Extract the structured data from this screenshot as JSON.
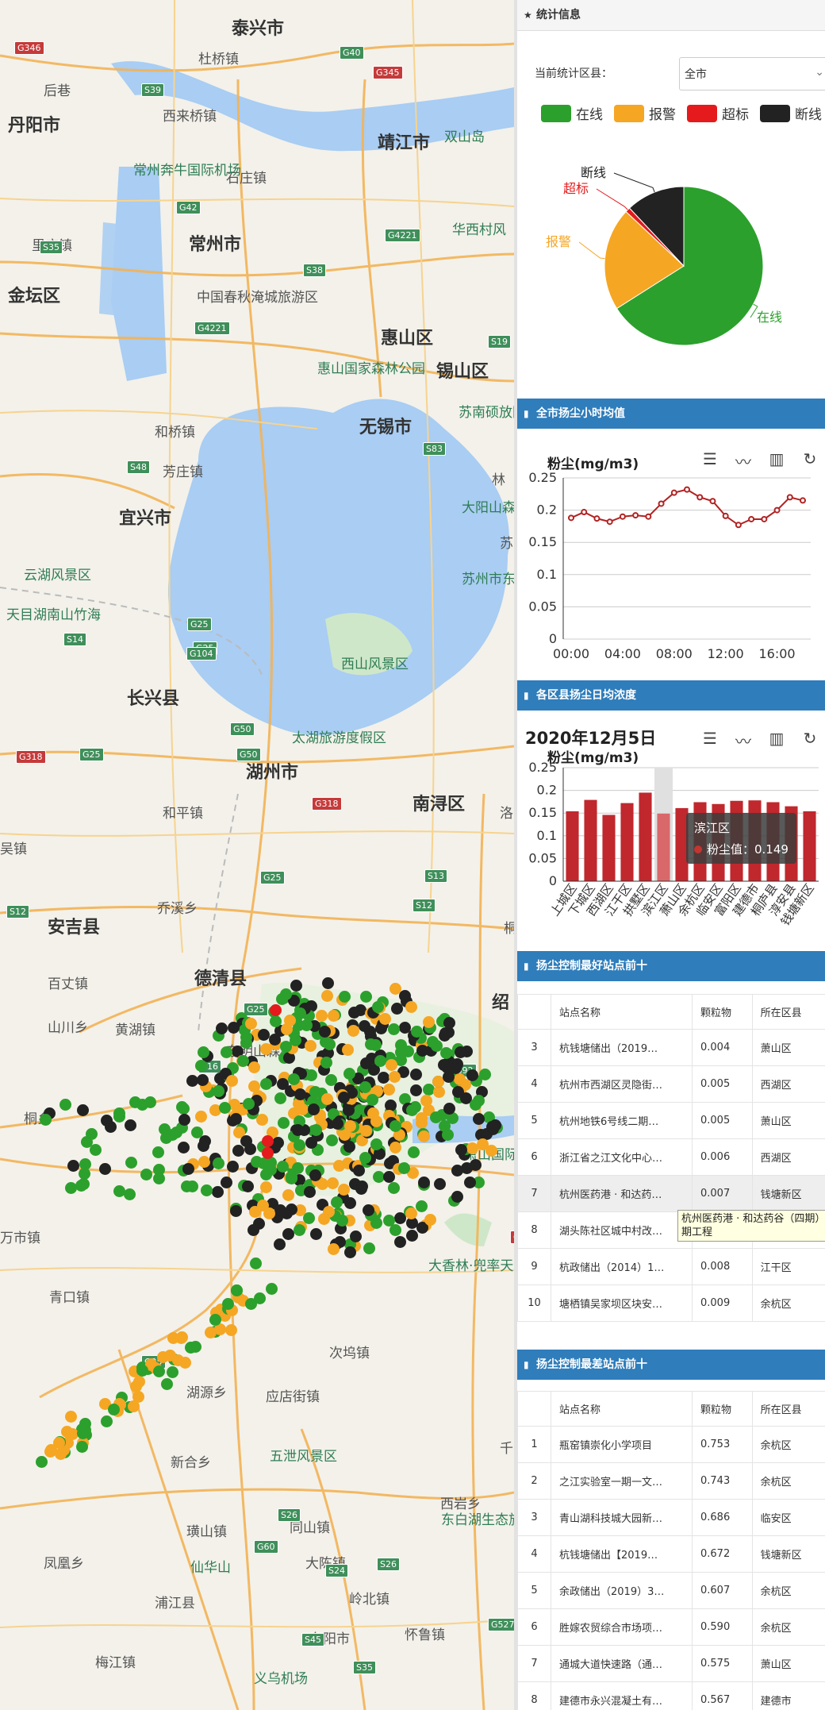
{
  "map": {
    "cities": [
      "泰兴市",
      "靖江市",
      "丹阳市",
      "常州市",
      "金坛区",
      "惠山区",
      "锡山区",
      "无锡市",
      "宜兴市",
      "长兴县",
      "湖州市",
      "德清县",
      "安吉县",
      "南浔区",
      "绍"
    ],
    "places": [
      "杜桥镇",
      "后巷",
      "西来桥镇",
      "石庄镇",
      "里庄镇",
      "中国春秋淹城旅游区",
      "和桥镇",
      "芳庄镇",
      "乔溪乡",
      "百丈镇",
      "山川乡",
      "黄湖镇",
      "东明山森林",
      "桐乡",
      "万市镇",
      "青口镇",
      "湖源乡",
      "应店街镇",
      "次坞镇",
      "新合乡",
      "西岩乡",
      "同山镇",
      "凤凰乡",
      "璜山镇",
      "大陈镇",
      "浦江县",
      "梅江镇",
      "东阳市",
      "怀鲁镇",
      "岭北镇",
      "和平镇",
      "吴镇",
      "洛",
      "桐",
      "苏",
      "林",
      "千"
    ],
    "pois": [
      "常州奔牛国际机场",
      "双山岛",
      "华西村风",
      "惠山国家森林公园",
      "苏南硕放国际机场",
      "大阳山森林公园",
      "苏州市东太湖旅游区",
      "云湖风景区",
      "天目湖南山竹海",
      "西山风景区",
      "太湖旅游度假区",
      "大香林·兜率天景区",
      "五泄风景区",
      "东白湖生态旅游区",
      "仙华山",
      "义乌机场",
      "萧山国际机场"
    ],
    "shields": [
      "G346",
      "G40",
      "G345",
      "S39",
      "G42",
      "S35",
      "G4221",
      "S38",
      "G4221",
      "S19",
      "S48",
      "S83",
      "G25",
      "G25",
      "S14",
      "G104",
      "G50",
      "G25",
      "G50",
      "G318",
      "G318",
      "G25",
      "S12",
      "S12",
      "S13",
      "G25",
      "S16",
      "G92",
      "G329",
      "G25",
      "S26",
      "G60",
      "S24",
      "G527",
      "S45",
      "S35",
      "S26"
    ]
  },
  "panel": {
    "stat_header": "统计信息",
    "stat_filter_label": "当前统计区县：",
    "stat_filter_value": "全市",
    "legend": [
      {
        "label": "在线",
        "color": "#2ca02c"
      },
      {
        "label": "报警",
        "color": "#f5a623"
      },
      {
        "label": "超标",
        "color": "#e41a1c"
      },
      {
        "label": "断线",
        "color": "#222222"
      }
    ],
    "hourly_header": "全市扬尘小时均值",
    "daily_header": "各区县扬尘日均浓度",
    "best_header": "扬尘控制最好站点前十",
    "worst_header": "扬尘控制最差站点前十",
    "table_cols": [
      "站点名称",
      "颗粒物",
      "所在区县"
    ],
    "best_rows": [
      {
        "no": "3",
        "name": "杭钱塘储出（2019…",
        "val": "0.004",
        "area": "萧山区"
      },
      {
        "no": "4",
        "name": "杭州市西湖区灵隐街…",
        "val": "0.005",
        "area": "西湖区"
      },
      {
        "no": "5",
        "name": "杭州地铁6号线二期…",
        "val": "0.005",
        "area": "萧山区"
      },
      {
        "no": "6",
        "name": "浙江省之江文化中心…",
        "val": "0.006",
        "area": "西湖区"
      },
      {
        "no": "7",
        "name": "杭州医药港 · 和达药…",
        "val": "0.007",
        "area": "钱塘新区"
      },
      {
        "no": "8",
        "name": "湖头陈社区城中村改…",
        "val": "0.007",
        "area": "萧山区"
      },
      {
        "no": "9",
        "name": "杭政储出（2014）1…",
        "val": "0.008",
        "area": "江干区"
      },
      {
        "no": "10",
        "name": "塘栖镇吴家坝区块安…",
        "val": "0.009",
        "area": "余杭区"
      }
    ],
    "best_tooltip": "杭州医药港 · 和达药谷（四期）期工程",
    "worst_rows": [
      {
        "no": "1",
        "name": "瓶窑镇崇化小学项目",
        "val": "0.753",
        "area": "余杭区"
      },
      {
        "no": "2",
        "name": "之江实验室一期一文…",
        "val": "0.743",
        "area": "余杭区"
      },
      {
        "no": "3",
        "name": "青山湖科技城大园新…",
        "val": "0.686",
        "area": "临安区"
      },
      {
        "no": "4",
        "name": "杭钱塘储出【2019…",
        "val": "0.672",
        "area": "钱塘新区"
      },
      {
        "no": "5",
        "name": "余政储出（2019）3…",
        "val": "0.607",
        "area": "余杭区"
      },
      {
        "no": "6",
        "name": "胜嫁农贸综合市场项…",
        "val": "0.590",
        "area": "余杭区"
      },
      {
        "no": "7",
        "name": "通城大道快速路（通…",
        "val": "0.575",
        "area": "萧山区"
      },
      {
        "no": "8",
        "name": "建德市永兴混凝土有…",
        "val": "0.567",
        "area": "建德市"
      }
    ],
    "daily_tooltip": {
      "title": "滨江区",
      "label": "粉尘值：0.149"
    }
  },
  "chart_data": [
    {
      "type": "pie",
      "categories": [
        "在线",
        "报警",
        "超标",
        "断线"
      ],
      "values": [
        66,
        21,
        1,
        12
      ],
      "colors": [
        "#2ca02c",
        "#f5a623",
        "#e41a1c",
        "#222222"
      ]
    },
    {
      "type": "line",
      "title": "粉尘(mg/m3)",
      "x": [
        "00:00",
        "01:00",
        "02:00",
        "03:00",
        "04:00",
        "05:00",
        "06:00",
        "07:00",
        "08:00",
        "09:00",
        "10:00",
        "11:00",
        "12:00",
        "13:00",
        "14:00",
        "15:00",
        "16:00",
        "17:00"
      ],
      "values": [
        0.188,
        0.197,
        0.187,
        0.182,
        0.19,
        0.192,
        0.19,
        0.21,
        0.227,
        0.232,
        0.22,
        0.214,
        0.191,
        0.177,
        0.186,
        0.186,
        0.2,
        0.22,
        0.215
      ],
      "xticks": [
        "00:00",
        "04:00",
        "08:00",
        "12:00",
        "16:00"
      ],
      "yticks": [
        "0",
        "0.05",
        "0.1",
        "0.15",
        "0.2",
        "0.25"
      ],
      "ylim": [
        0,
        0.25
      ],
      "color": "#b22222"
    },
    {
      "type": "bar",
      "title": "2020年12月5日",
      "subtitle": "粉尘(mg/m3)",
      "categories": [
        "上城区",
        "下城区",
        "西湖区",
        "江干区",
        "拱墅区",
        "滨江区",
        "萧山区",
        "余杭区",
        "临安区",
        "富阳区",
        "建德市",
        "桐庐县",
        "淳安县",
        "钱塘新区"
      ],
      "values": [
        0.154,
        0.179,
        0.146,
        0.172,
        0.195,
        0.149,
        0.161,
        0.174,
        0.17,
        0.177,
        0.178,
        0.174,
        0.165,
        0.154
      ],
      "yticks": [
        "0",
        "0.05",
        "0.1",
        "0.15",
        "0.2",
        "0.25"
      ],
      "ylim": [
        0,
        0.25
      ],
      "color": "#c0282d"
    }
  ]
}
